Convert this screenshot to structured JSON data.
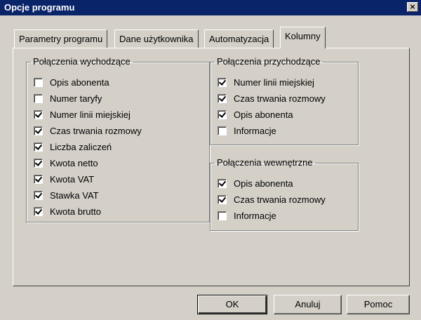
{
  "window": {
    "title": "Opcje programu",
    "close_label": "×"
  },
  "tabs": [
    {
      "label": "Parametry programu",
      "active": false
    },
    {
      "label": "Dane użytkownika",
      "active": false
    },
    {
      "label": "Automatyzacja",
      "active": false
    },
    {
      "label": "Kolumny",
      "active": true
    }
  ],
  "groups": {
    "outgoing": {
      "title": "Połączenia wychodzące",
      "items": [
        {
          "label": "Opis abonenta",
          "checked": false
        },
        {
          "label": "Numer taryfy",
          "checked": false
        },
        {
          "label": "Numer linii miejskiej",
          "checked": true
        },
        {
          "label": "Czas trwania rozmowy",
          "checked": true
        },
        {
          "label": "Liczba zaliczeń",
          "checked": true
        },
        {
          "label": "Kwota netto",
          "checked": true
        },
        {
          "label": "Kwota VAT",
          "checked": true
        },
        {
          "label": "Stawka VAT",
          "checked": true
        },
        {
          "label": "Kwota brutto",
          "checked": true
        }
      ]
    },
    "incoming": {
      "title": "Połączenia przychodzące",
      "items": [
        {
          "label": "Numer linii miejskiej",
          "checked": true
        },
        {
          "label": "Czas trwania rozmowy",
          "checked": true
        },
        {
          "label": "Opis abonenta",
          "checked": true
        },
        {
          "label": "Informacje",
          "checked": false
        }
      ]
    },
    "internal": {
      "title": "Połączenia wewnętrzne",
      "items": [
        {
          "label": "Opis abonenta",
          "checked": true
        },
        {
          "label": "Czas trwania rozmowy",
          "checked": true
        },
        {
          "label": "Informacje",
          "checked": false
        }
      ]
    }
  },
  "buttons": {
    "ok": "OK",
    "cancel": "Anuluj",
    "help": "Pomoc"
  }
}
